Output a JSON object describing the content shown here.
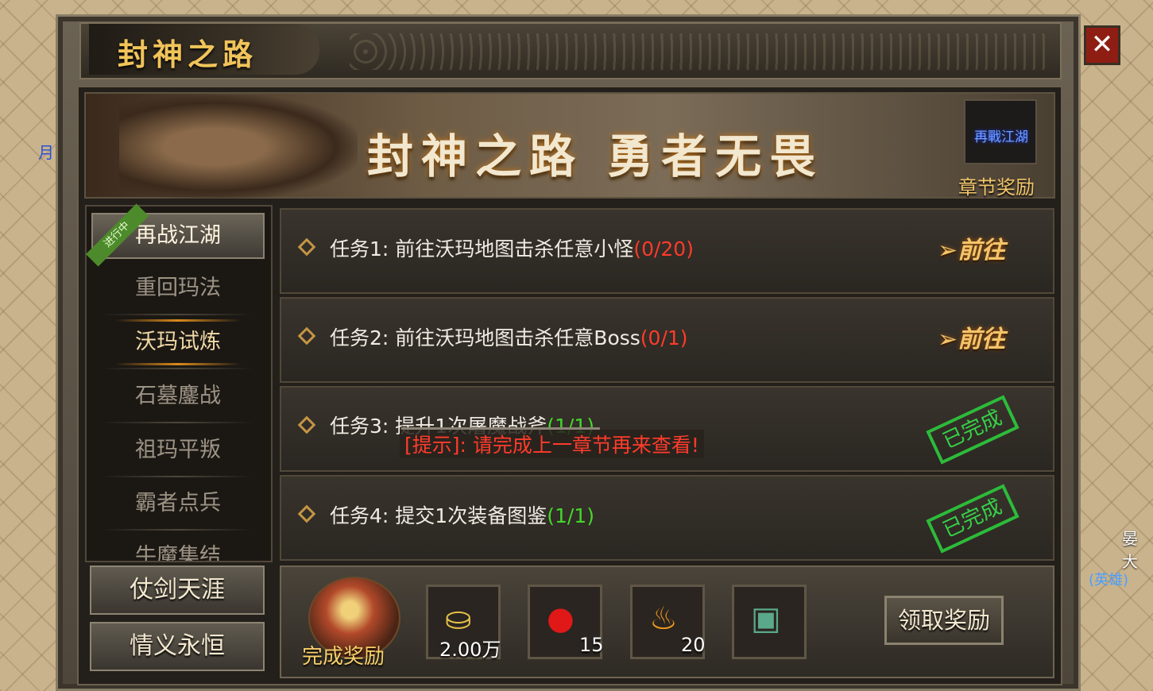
{
  "window": {
    "title": "封神之路",
    "close_label": "✕"
  },
  "banner": {
    "text": "封神之路 勇者无畏",
    "chapter_icon_text": "再戰江湖",
    "chapter_reward_label": "章节奖励"
  },
  "sidebar": {
    "ribbon": "进行中",
    "items": [
      {
        "label": "再战江湖"
      },
      {
        "label": "重回玛法"
      },
      {
        "label": "沃玛试炼"
      },
      {
        "label": "石墓鏖战"
      },
      {
        "label": "祖玛平叛"
      },
      {
        "label": "霸者点兵"
      },
      {
        "label": "牛魔集结"
      }
    ],
    "buttons": [
      {
        "label": "仗剑天涯"
      },
      {
        "label": "情义永恒"
      }
    ]
  },
  "tasks": [
    {
      "prefix": "任务1:",
      "desc": "前往沃玛地图击杀任意小怪",
      "progress": "(0/20)",
      "action": "前往"
    },
    {
      "prefix": "任务2:",
      "desc": "前往沃玛地图击杀任意Boss",
      "progress": "(0/1)",
      "action": "前往"
    },
    {
      "prefix": "任务3:",
      "desc": "提升1次屠魔战斧",
      "progress": "(1/1)",
      "status": "已完成"
    },
    {
      "prefix": "任务4:",
      "desc": "提交1次装备图鉴",
      "progress": "(1/1)",
      "status": "已完成"
    }
  ],
  "hint": "[提示]: 请完成上一章节再来查看!",
  "rewards": {
    "label": "完成奖励",
    "items": [
      {
        "icon": "gold-ingot-icon",
        "qty": "2.00万"
      },
      {
        "icon": "red-fruit-icon",
        "qty": "15"
      },
      {
        "icon": "flame-icon",
        "qty": "20"
      },
      {
        "icon": "treasure-chest-icon",
        "qty": ""
      }
    ],
    "claim_label": "领取奖励"
  },
  "background": {
    "left_text": "月",
    "right_text": "晏大",
    "hero_tag": "(英雄)"
  },
  "colors": {
    "progress_incomplete": "#ff3b2b",
    "progress_complete": "#45d62c",
    "accent_gold": "#f1c45a",
    "close_red": "#8e1e14"
  }
}
